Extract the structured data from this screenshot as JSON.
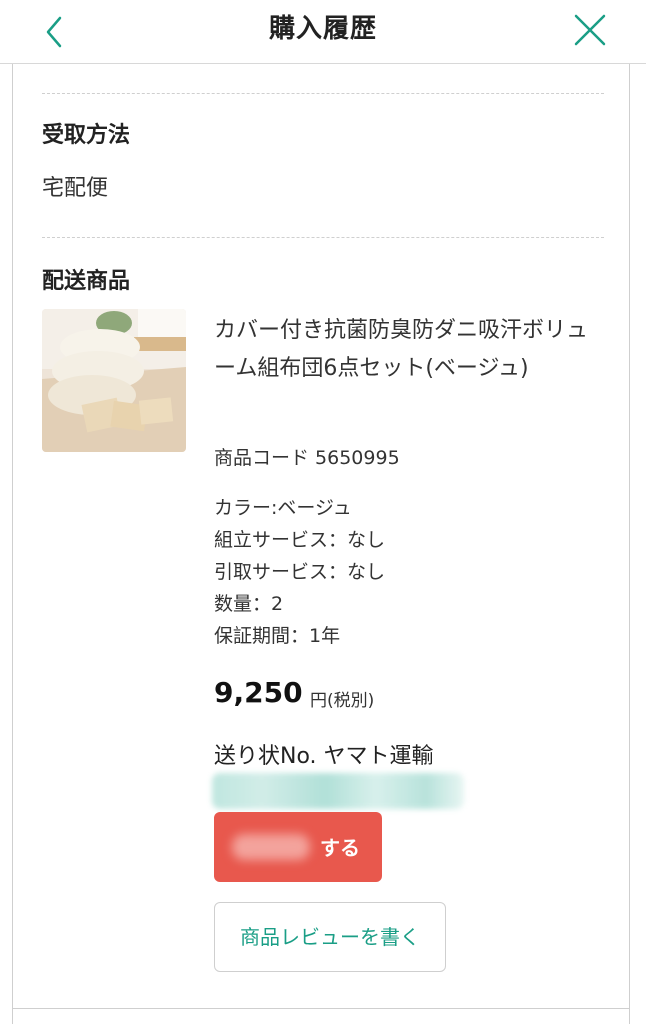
{
  "header": {
    "title": "購入履歴",
    "back_icon": "chevron-left-icon",
    "close_icon": "close-icon",
    "accent_color": "#1a9e86"
  },
  "receipt": {
    "title": "受取方法",
    "value": "宅配便"
  },
  "delivery": {
    "title": "配送商品",
    "product": {
      "name": "カバー付き抗菌防臭防ダニ吸汗ボリューム組布団6点セット(ベージュ)",
      "code": "商品コード 5650995",
      "specs": [
        "カラー:ベージュ",
        "組立サービス：なし",
        "引取サービス：なし",
        "数量：2",
        "保証期間：1年"
      ],
      "price": "9,250",
      "price_unit": "円(税別)",
      "invoice": "送り状No. ヤマト運輸"
    },
    "action_button": "する",
    "review_button": "商品レビューを書く",
    "action_color": "#e8584d"
  }
}
